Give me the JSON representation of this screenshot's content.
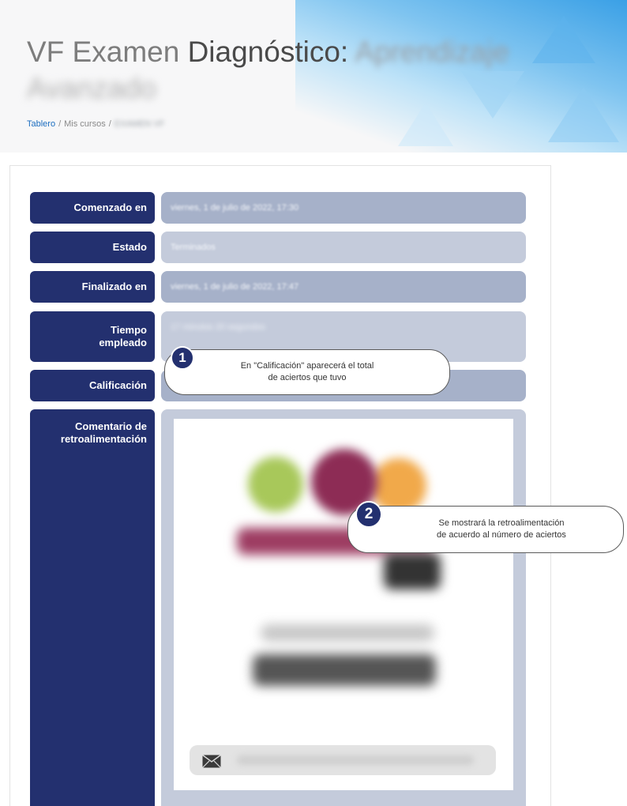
{
  "header": {
    "title_part1": "VF Examen",
    "title_part2": "Diagnóstico:",
    "title_blurred": "Aprendizaje",
    "title_line2_blurred": "Avanzado",
    "breadcrumb": {
      "item1": "Tablero",
      "sep": "/",
      "item2": "Mis cursos",
      "item3_blurred": "EXAMEN VF"
    }
  },
  "summary": {
    "rows": [
      {
        "label": "Comenzado en",
        "value": "viernes, 1 de julio de 2022, 17:30"
      },
      {
        "label": "Estado",
        "value": "Terminados"
      },
      {
        "label": "Finalizado en",
        "value": "viernes, 1 de julio de 2022, 17:47"
      },
      {
        "label_line1": "Tiempo",
        "label_line2": "empleado",
        "value": "17 minutos 20 segundos"
      },
      {
        "label": "Calificación",
        "value": ""
      },
      {
        "label_line1": "Comentario de",
        "label_line2": "retroalimentación"
      }
    ]
  },
  "callouts": [
    {
      "number": "1",
      "line1": "En \"Calificación\" aparecerá el total",
      "line2": "de aciertos que tuvo"
    },
    {
      "number": "2",
      "line1": "Se mostrará la retroalimentación",
      "line2": "de acuerdo al número de aciertos"
    }
  ],
  "icons": {
    "mail": "mail-icon"
  },
  "colors": {
    "label_bg": "#23306f",
    "value_dark": "#a6b1c9",
    "value_light": "#c4cbdb",
    "link": "#1c6ec0"
  }
}
